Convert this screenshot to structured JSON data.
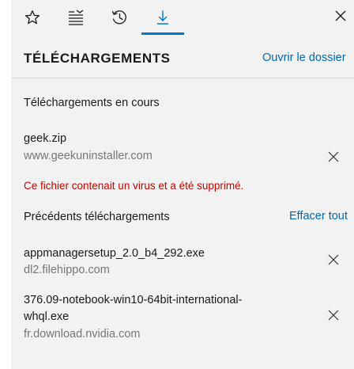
{
  "tabs": [
    {
      "name": "favorites",
      "icon": "star-icon",
      "active": false
    },
    {
      "name": "reading-list",
      "icon": "reading-list-icon",
      "active": false
    },
    {
      "name": "history",
      "icon": "history-icon",
      "active": false
    },
    {
      "name": "downloads",
      "icon": "download-icon",
      "active": true
    }
  ],
  "header": {
    "title": "TÉLÉCHARGEMENTS",
    "open_folder_label": "Ouvrir le dossier"
  },
  "current": {
    "section_title": "Téléchargements en cours",
    "items": [
      {
        "name": "geek.zip",
        "source": "www.geekuninstaller.com",
        "warning": "Ce fichier contenait un virus et a été supprimé."
      }
    ]
  },
  "previous": {
    "section_title": "Précédents téléchargements",
    "clear_all_label": "Effacer tout",
    "items": [
      {
        "name": "appmanagersetup_2.0_b4_292.exe",
        "source": "dl2.filehippo.com"
      },
      {
        "name": "376.09-notebook-win10-64bit-international-whql.exe",
        "source": "fr.download.nvidia.com"
      }
    ]
  },
  "colors": {
    "accent": "#0078d7",
    "link": "#0067b8",
    "warning": "#c50500",
    "secondary_text": "#767676",
    "pane_background": "#f2f2f2"
  }
}
